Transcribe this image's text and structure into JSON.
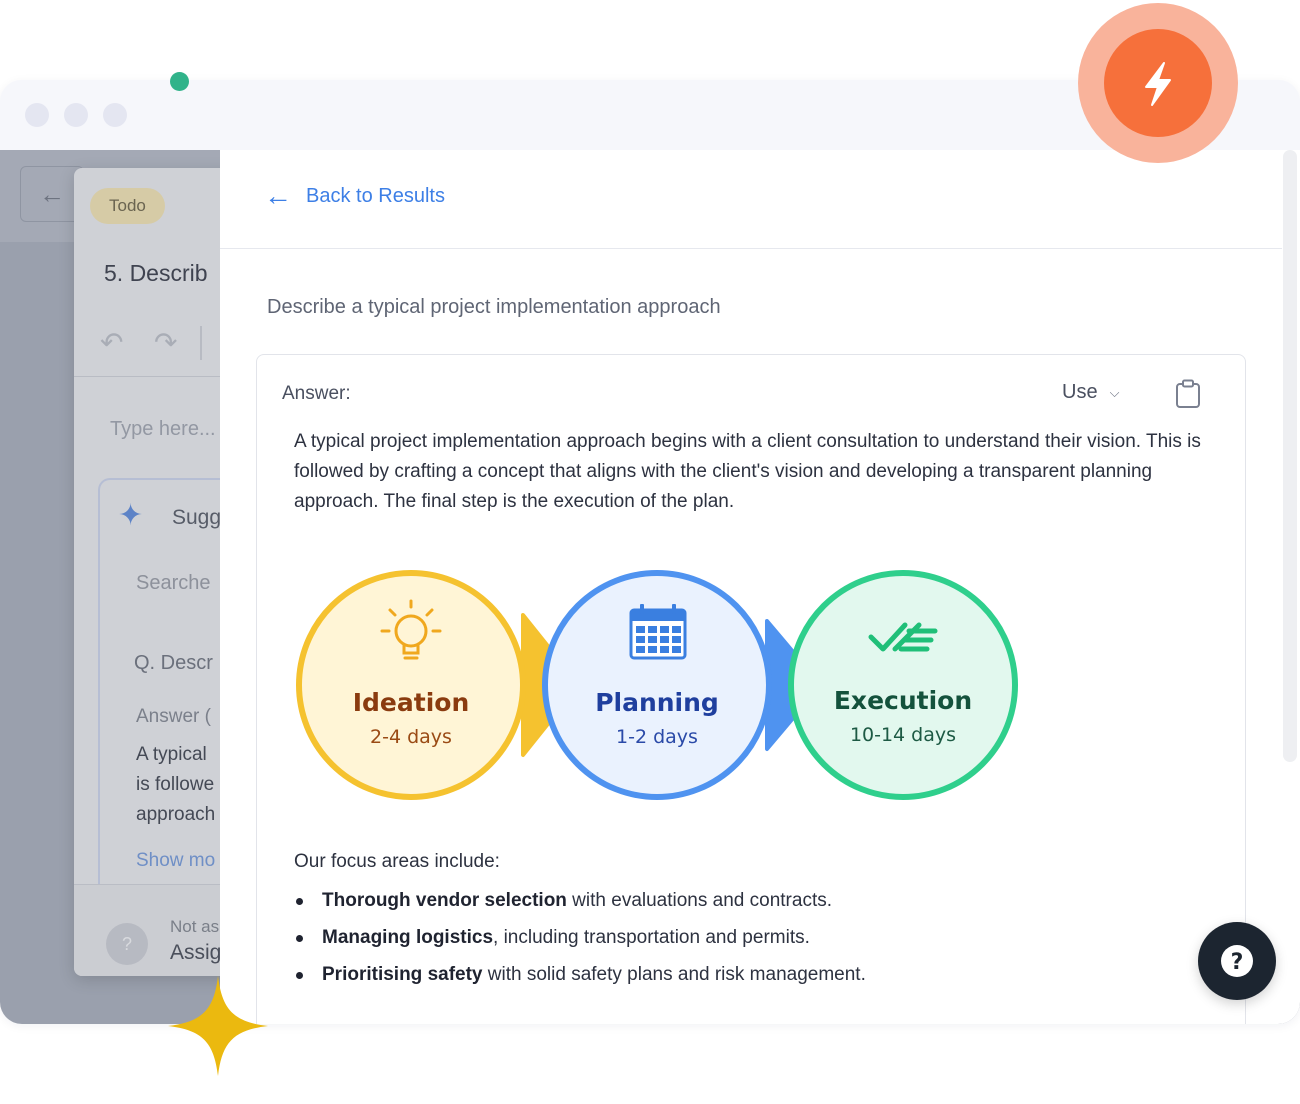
{
  "background_app": {
    "badge": "Todo",
    "title": "5. Describ",
    "placeholder": "Type here...",
    "suggestions_label": "Sugg",
    "searched_label": "Searche",
    "question": "Q. Descr",
    "answer_label": "Answer (",
    "answer_lines": [
      "A typical",
      "is followe",
      "approach"
    ],
    "show_more": "Show mo",
    "assignee_status": "Not as",
    "assignee_action": "Assig",
    "avatar_glyph": "?"
  },
  "panel": {
    "back_label": "Back to Results",
    "question": "Describe a typical project implementation approach",
    "answer": {
      "label": "Answer:",
      "use_label": "Use",
      "body": "A typical project implementation approach begins with a client consultation to understand their vision. This is followed by crafting a concept that aligns with the client's vision and developing a transparent planning approach. The final step is the execution of the plan."
    },
    "phases": [
      {
        "name": "Ideation",
        "duration": "2-4 days",
        "icon": "lightbulb-icon",
        "color": "#f5c22f",
        "fill": "#fff5d6",
        "text_color": "#8a3b0f",
        "sub_color": "#9a4a14"
      },
      {
        "name": "Planning",
        "duration": "1-2 days",
        "icon": "calendar-icon",
        "color": "#4f93f0",
        "fill": "#eaf2fe",
        "text_color": "#1f3f9e",
        "sub_color": "#2a4aa8"
      },
      {
        "name": "Execution",
        "duration": "10-14 days",
        "icon": "checklist-icon",
        "color": "#2fcf8c",
        "fill": "#e2f8ee",
        "text_color": "#14523c",
        "sub_color": "#1d5a44"
      }
    ],
    "focus_intro": "Our focus areas include:",
    "focus_items": [
      {
        "bold": "Thorough vendor selection",
        "rest": " with evaluations and contracts."
      },
      {
        "bold": "Managing logistics",
        "rest": ", including transportation and permits."
      },
      {
        "bold": "Prioritising safety",
        "rest": " with solid safety plans and risk management."
      }
    ],
    "help_glyph": "?"
  },
  "colors": {
    "accent": "#3d7fe6",
    "bolt_ring": "#f9b39b",
    "bolt_core": "#f6703b",
    "dot_green": "#31b38a",
    "sparkle_gold": "#ebb90f"
  }
}
